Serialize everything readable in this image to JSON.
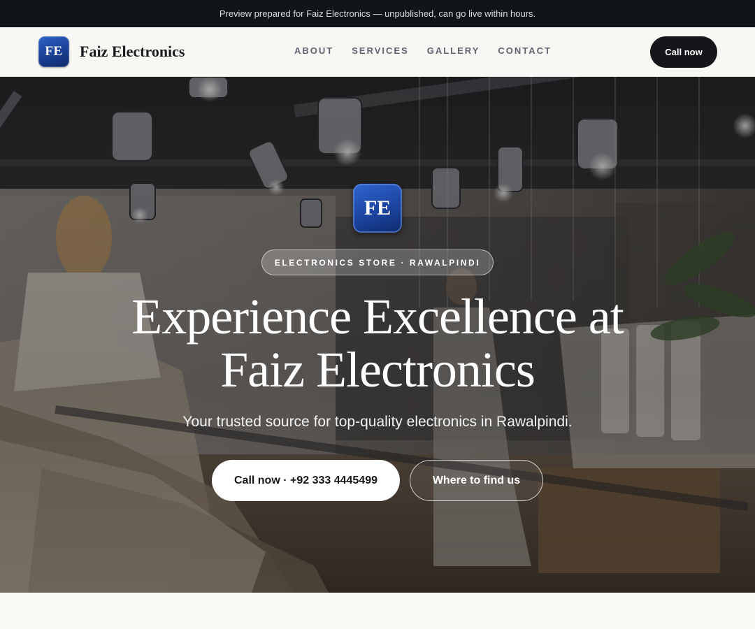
{
  "announcement": {
    "text": "Preview prepared for Faiz Electronics — unpublished, can go live within hours."
  },
  "header": {
    "logo_text": "FE",
    "brand_name": "Faiz Electronics",
    "nav": [
      {
        "label": "ABOUT"
      },
      {
        "label": "SERVICES"
      },
      {
        "label": "GALLERY"
      },
      {
        "label": "CONTACT"
      }
    ],
    "cta_label": "Call now"
  },
  "hero": {
    "logo_text": "FE",
    "eyebrow": "ELECTRONICS STORE · RAWALPINDI",
    "title_line1": "Experience Excellence at",
    "title_line2": "Faiz Electronics",
    "subtitle": "Your trusted source for top-quality electronics in Rawalpindi.",
    "primary_button": "Call now · +92 333 4445499",
    "secondary_button": "Where to find us",
    "background_image": "store-interior-photo"
  },
  "colors": {
    "topbar_bg": "#111418",
    "brand_blue": "#1c44a0",
    "cta_dark": "#15161a",
    "page_bg": "#f8f7f4"
  }
}
